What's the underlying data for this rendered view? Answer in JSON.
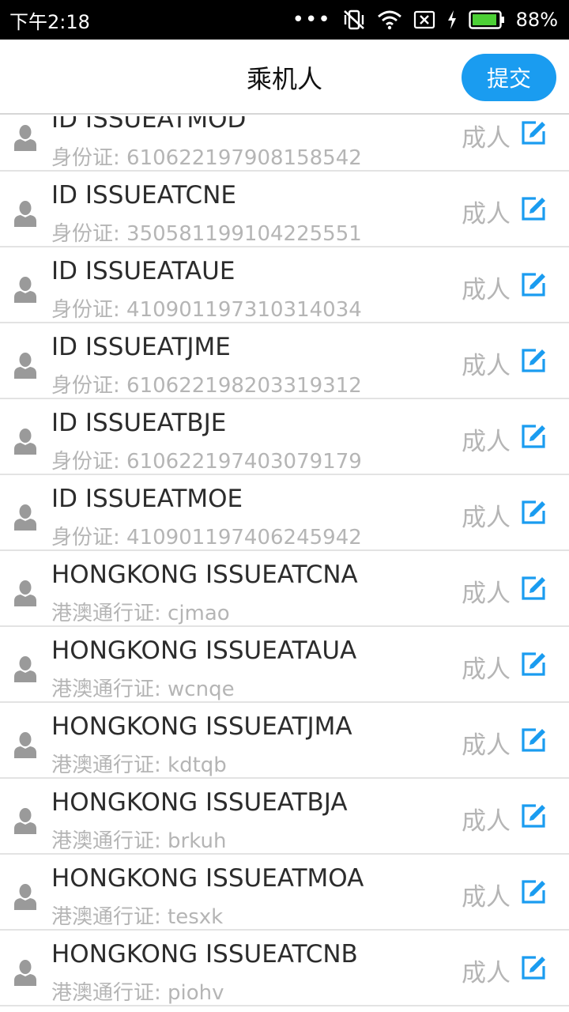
{
  "status_bar": {
    "time": "下午2:18",
    "battery": "88%",
    "icons": [
      "more-dots-icon",
      "vibrate-off-icon",
      "wifi-icon",
      "sim-off-icon",
      "charging-bolt-icon",
      "battery-icon"
    ]
  },
  "header": {
    "title": "乘机人",
    "submit_label": "提交"
  },
  "colors": {
    "accent": "#1a9cf0",
    "person_icon": "#9a9a9a",
    "secondary_text": "#b5b5b5"
  },
  "passengers": [
    {
      "name": "ID ISSUEATMOD",
      "doc": "身份证: 610622197908158542",
      "type": "成人"
    },
    {
      "name": "ID ISSUEATCNE",
      "doc": "身份证: 350581199104225551",
      "type": "成人"
    },
    {
      "name": "ID ISSUEATAUE",
      "doc": "身份证: 410901197310314034",
      "type": "成人"
    },
    {
      "name": "ID ISSUEATJME",
      "doc": "身份证: 610622198203319312",
      "type": "成人"
    },
    {
      "name": "ID ISSUEATBJE",
      "doc": "身份证: 610622197403079179",
      "type": "成人"
    },
    {
      "name": "ID ISSUEATMOE",
      "doc": "身份证: 410901197406245942",
      "type": "成人"
    },
    {
      "name": "HONGKONG ISSUEATCNA",
      "doc": "港澳通行证: cjmao",
      "type": "成人"
    },
    {
      "name": "HONGKONG ISSUEATAUA",
      "doc": "港澳通行证: wcnqe",
      "type": "成人"
    },
    {
      "name": "HONGKONG ISSUEATJMA",
      "doc": "港澳通行证: kdtqb",
      "type": "成人"
    },
    {
      "name": "HONGKONG ISSUEATBJA",
      "doc": "港澳通行证: brkuh",
      "type": "成人"
    },
    {
      "name": "HONGKONG ISSUEATMOA",
      "doc": "港澳通行证: tesxk",
      "type": "成人"
    },
    {
      "name": "HONGKONG ISSUEATCNB",
      "doc": "港澳通行证: piohv",
      "type": "成人"
    }
  ]
}
